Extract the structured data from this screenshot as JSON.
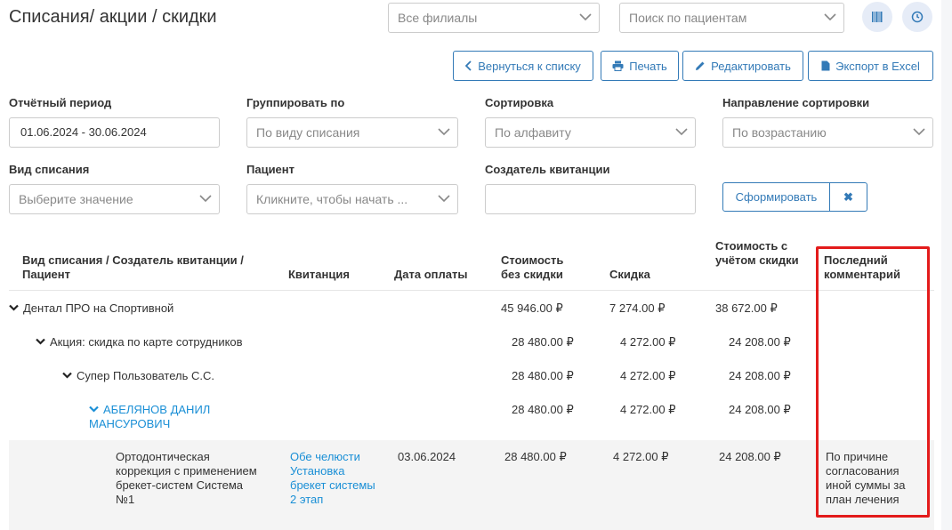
{
  "header": {
    "title": "Списания/ акции / скидки",
    "branch_select": "Все филиалы",
    "patient_search_placeholder": "Поиск по пациентам"
  },
  "toolbar": {
    "back_label": "Вернуться к списку",
    "print_label": "Печать",
    "edit_label": "Редактировать",
    "export_label": "Экспорт в Excel"
  },
  "filters": {
    "period_label": "Отчётный период",
    "period_value": "01.06.2024 - 30.06.2024",
    "group_label": "Группировать по",
    "group_value": "По виду списания",
    "sort_label": "Сортировка",
    "sort_value": "По алфавиту",
    "direction_label": "Направление сортировки",
    "direction_value": "По возрастанию",
    "writeoff_type_label": "Вид списания",
    "writeoff_type_placeholder": "Выберите значение",
    "patient_label": "Пациент",
    "patient_placeholder": "Кликните, чтобы начать ...",
    "creator_label": "Создатель квитанции",
    "creator_value": "",
    "submit_label": "Сформировать",
    "clear_symbol": "✖"
  },
  "table": {
    "headers": {
      "type": "Вид списания / Создатель квитанции / Пациент",
      "receipt": "Квитанция",
      "pay_date": "Дата оплаты",
      "cost": "Стоимость без скидки",
      "discount": "Скидка",
      "cost_after": "Стоимость с учётом скидки",
      "comment": "Последний комментарий"
    },
    "rows": [
      {
        "label": "Дентал ПРО на Спортивной",
        "cost": "45 946.00 ₽",
        "discount": "7 274.00 ₽",
        "cost_after": "38 672.00 ₽"
      },
      {
        "label": "Акция: скидка по карте сотрудников",
        "cost": "28 480.00 ₽",
        "discount": "4 272.00 ₽",
        "cost_after": "24 208.00 ₽"
      },
      {
        "label": "Супер Пользователь С.С.",
        "cost": "28 480.00 ₽",
        "discount": "4 272.00 ₽",
        "cost_after": "24 208.00 ₽"
      },
      {
        "label": "АБЕЛЯНОВ ДАНИЛ МАНСУРОВИЧ",
        "cost": "28 480.00 ₽",
        "discount": "4 272.00 ₽",
        "cost_after": "24 208.00 ₽"
      }
    ],
    "detail": {
      "service": "Ортодонтическая коррекция с применением брекет-систем Система №1",
      "receipt": "Обе челюсти Установка брекет системы 2 этап",
      "pay_date": "03.06.2024",
      "cost": "28 480.00 ₽",
      "discount": "4 272.00 ₽",
      "cost_after": "24 208.00 ₽",
      "comment": "По причине согласования иной суммы за план лечения"
    }
  },
  "colors": {
    "accent": "#337ab7",
    "link": "#1a8fd6",
    "highlight": "#e31b1b"
  }
}
